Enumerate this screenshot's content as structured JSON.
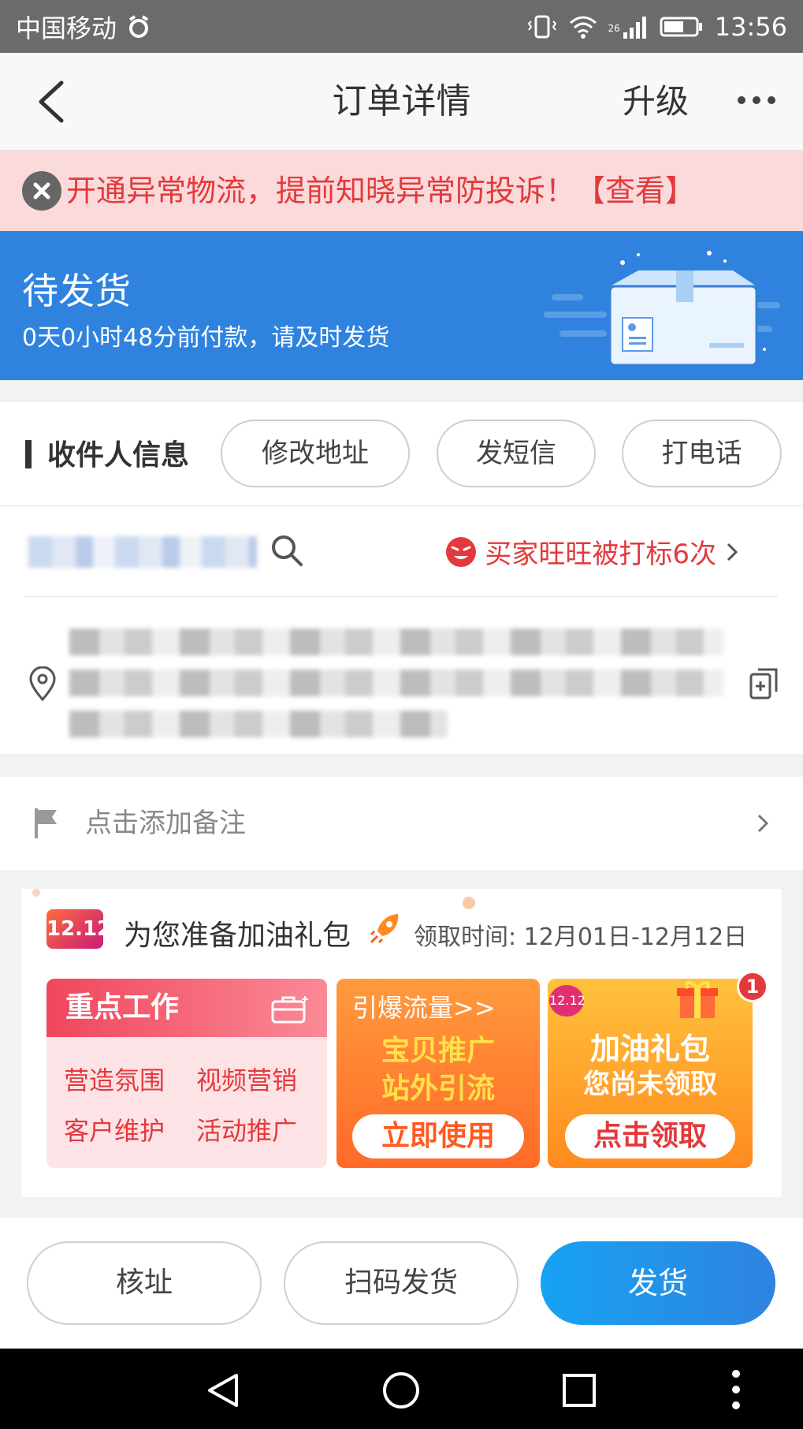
{
  "status_bar": {
    "carrier": "中国移动",
    "network": "26",
    "time": "13:56"
  },
  "nav": {
    "title": "订单详情",
    "upgrade": "升级"
  },
  "alert": {
    "text": "开通异常物流，提前知晓异常防投诉！【查看】"
  },
  "order_status": {
    "title": "待发货",
    "subtitle": "0天0小时48分前付款，请及时发货"
  },
  "receiver": {
    "section_title": "收件人信息",
    "buttons": [
      "修改地址",
      "发短信",
      "打电话"
    ],
    "buyer_flag": "买家旺旺被打标6次"
  },
  "remark": {
    "placeholder": "点击添加备注"
  },
  "promo": {
    "badge": "12.12",
    "title": "为您准备加油礼包",
    "time": "领取时间: 12月01日-12月12日",
    "card1": {
      "header": "重点工作",
      "items": [
        "营造氛围",
        "视频营销",
        "客户维护",
        "活动推广"
      ]
    },
    "card2": {
      "top": "引爆流量>>",
      "line1": "宝贝推广",
      "line2": "站外引流",
      "button": "立即使用"
    },
    "card3": {
      "badge": "12.12",
      "line1": "加油礼包",
      "line2": "您尚未领取",
      "button": "点击领取",
      "count": "1"
    }
  },
  "actions": {
    "verify": "核址",
    "scan_ship": "扫码发货",
    "ship": "发货"
  },
  "colors": {
    "accent": "#2f83df",
    "alert_red": "#e4393c",
    "ship_button": "#1a9cf0"
  }
}
